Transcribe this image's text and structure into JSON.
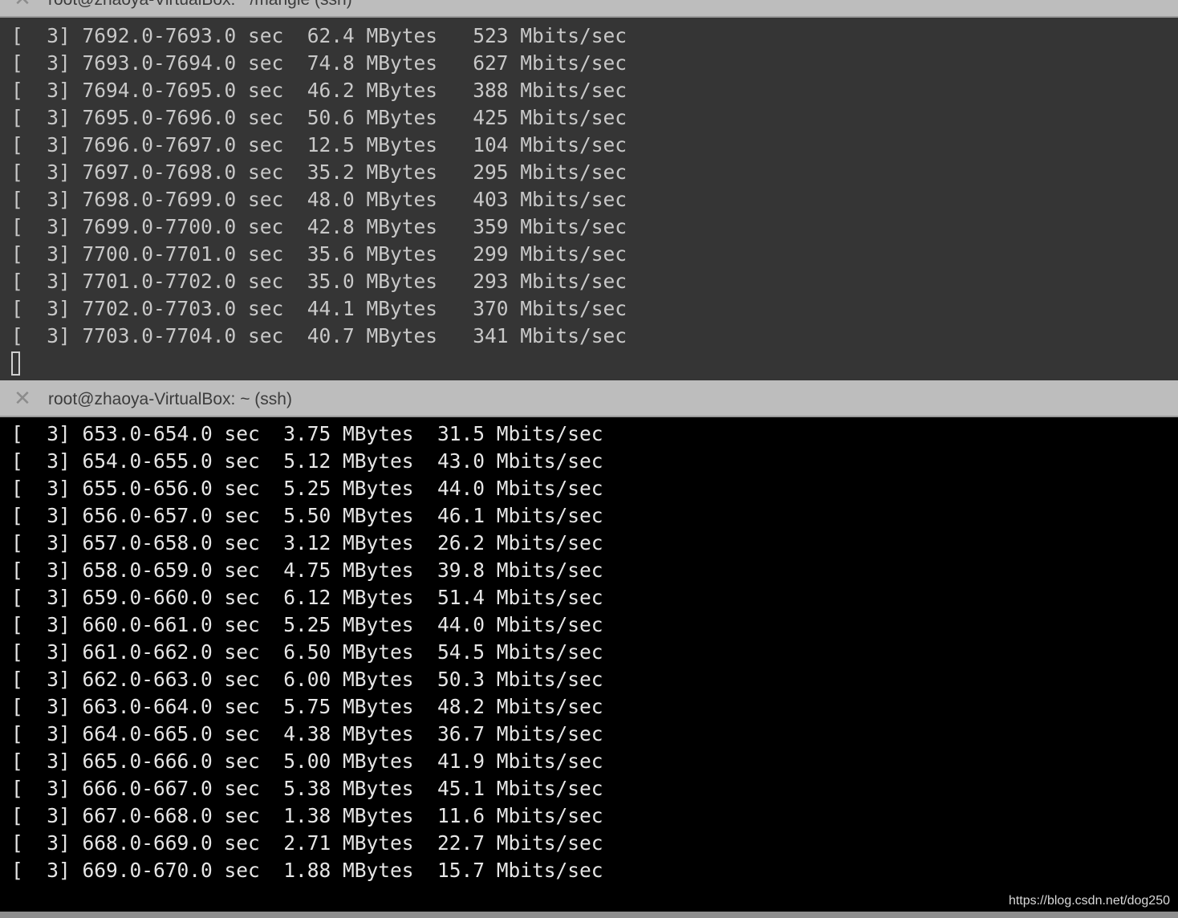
{
  "top_pane": {
    "tab_title": "root@zhaoya-VirtualBox: ~/mangle (ssh)",
    "lines": [
      "[  3] 7692.0-7693.0 sec  62.4 MBytes   523 Mbits/sec",
      "[  3] 7693.0-7694.0 sec  74.8 MBytes   627 Mbits/sec",
      "[  3] 7694.0-7695.0 sec  46.2 MBytes   388 Mbits/sec",
      "[  3] 7695.0-7696.0 sec  50.6 MBytes   425 Mbits/sec",
      "[  3] 7696.0-7697.0 sec  12.5 MBytes   104 Mbits/sec",
      "[  3] 7697.0-7698.0 sec  35.2 MBytes   295 Mbits/sec",
      "[  3] 7698.0-7699.0 sec  48.0 MBytes   403 Mbits/sec",
      "[  3] 7699.0-7700.0 sec  42.8 MBytes   359 Mbits/sec",
      "[  3] 7700.0-7701.0 sec  35.6 MBytes   299 Mbits/sec",
      "[  3] 7701.0-7702.0 sec  35.0 MBytes   293 Mbits/sec",
      "[  3] 7702.0-7703.0 sec  44.1 MBytes   370 Mbits/sec",
      "[  3] 7703.0-7704.0 sec  40.7 MBytes   341 Mbits/sec"
    ]
  },
  "bottom_pane": {
    "tab_title": "root@zhaoya-VirtualBox: ~ (ssh)",
    "lines": [
      "[  3] 653.0-654.0 sec  3.75 MBytes  31.5 Mbits/sec",
      "[  3] 654.0-655.0 sec  5.12 MBytes  43.0 Mbits/sec",
      "[  3] 655.0-656.0 sec  5.25 MBytes  44.0 Mbits/sec",
      "[  3] 656.0-657.0 sec  5.50 MBytes  46.1 Mbits/sec",
      "[  3] 657.0-658.0 sec  3.12 MBytes  26.2 Mbits/sec",
      "[  3] 658.0-659.0 sec  4.75 MBytes  39.8 Mbits/sec",
      "[  3] 659.0-660.0 sec  6.12 MBytes  51.4 Mbits/sec",
      "[  3] 660.0-661.0 sec  5.25 MBytes  44.0 Mbits/sec",
      "[  3] 661.0-662.0 sec  6.50 MBytes  54.5 Mbits/sec",
      "[  3] 662.0-663.0 sec  6.00 MBytes  50.3 Mbits/sec",
      "[  3] 663.0-664.0 sec  5.75 MBytes  48.2 Mbits/sec",
      "[  3] 664.0-665.0 sec  4.38 MBytes  36.7 Mbits/sec",
      "[  3] 665.0-666.0 sec  5.00 MBytes  41.9 Mbits/sec",
      "[  3] 666.0-667.0 sec  5.38 MBytes  45.1 Mbits/sec",
      "[  3] 667.0-668.0 sec  1.38 MBytes  11.6 Mbits/sec",
      "[  3] 668.0-669.0 sec  2.71 MBytes  22.7 Mbits/sec",
      "[  3] 669.0-670.0 sec  1.88 MBytes  15.7 Mbits/sec"
    ]
  },
  "close_glyph": "✕",
  "watermark": "https://blog.csdn.net/dog250"
}
